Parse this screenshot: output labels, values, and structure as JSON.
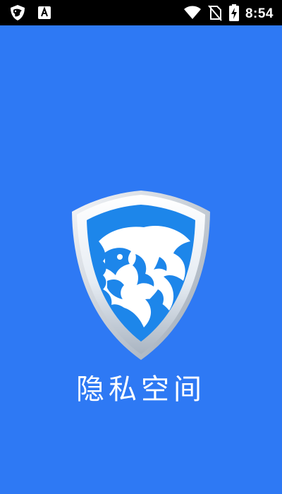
{
  "status_bar": {
    "time": "8:54",
    "icons": {
      "left": [
        "lion-shield-notification-icon",
        "font-a-notification-icon"
      ],
      "right": [
        "wifi-icon",
        "no-sim-icon",
        "battery-charging-icon"
      ]
    }
  },
  "app": {
    "name": "隐私空间",
    "logo_icon": "lion-shield-logo-icon"
  },
  "colors": {
    "background": "#2e79f4",
    "status_bar": "#000000",
    "logo_blue": "#1d86ea",
    "text": "#ffffff"
  }
}
